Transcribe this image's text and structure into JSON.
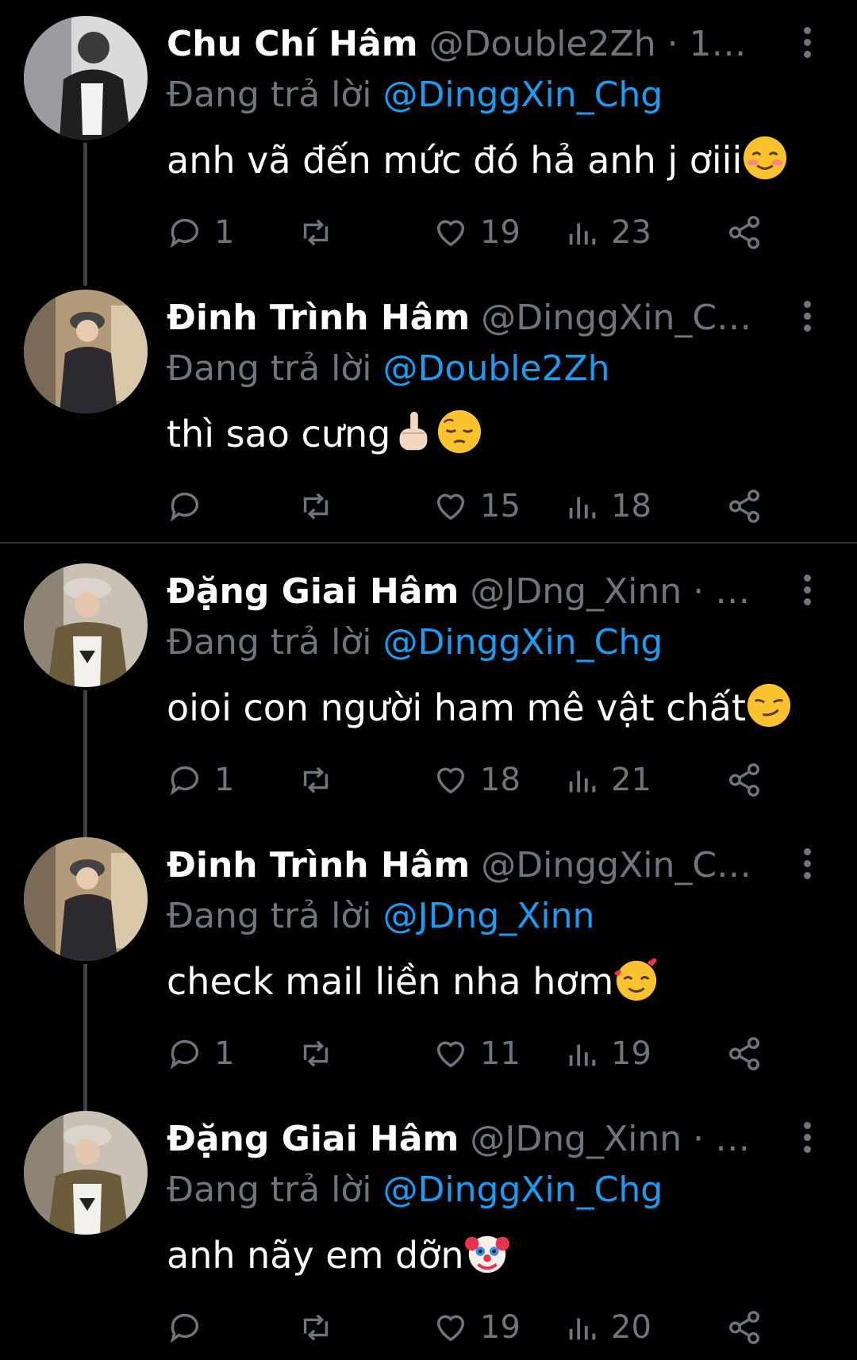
{
  "colors": {
    "background": "#000000",
    "handle_gray": "#6e767d",
    "mention_blue": "#1d9bf0",
    "thread_line": "#3d4247"
  },
  "reply_label": "Đang trả lời",
  "tweets": [
    {
      "name": "Chu Chí Hâm",
      "handle": "@Double2Zh · 1…",
      "mention": "@DinggXin_Chg",
      "text": "anh vã đến mức đó hả anh j ơiii",
      "emojis": [
        "smiling-blush-emoji"
      ],
      "replies": "1",
      "retweets": "",
      "likes": "19",
      "views": "23"
    },
    {
      "name": "Đinh Trình Hâm",
      "handle": "@DinggXin_C…",
      "mention": "@Double2Zh",
      "text": "thì sao cưng",
      "emojis": [
        "middle-finger-emoji",
        "pensive-emoji"
      ],
      "replies": "",
      "retweets": "",
      "likes": "15",
      "views": "18"
    },
    {
      "name": "Đặng Giai Hâm",
      "handle": "@JDng_Xinn · …",
      "mention": "@DinggXin_Chg",
      "text": "oioi con người ham mê vật chất",
      "emojis": [
        "smirk-emoji"
      ],
      "replies": "1",
      "retweets": "",
      "likes": "18",
      "views": "21"
    },
    {
      "name": "Đinh Trình Hâm",
      "handle": "@DinggXin_C…",
      "mention": "@JDng_Xinn",
      "text": "check mail liền nha hơm",
      "emojis": [
        "smiling-hearts-emoji"
      ],
      "replies": "1",
      "retweets": "",
      "likes": "11",
      "views": "19"
    },
    {
      "name": "Đặng Giai Hâm",
      "handle": "@JDng_Xinn · …",
      "mention": "@DinggXin_Chg",
      "text": "anh nãy em dỡn",
      "emojis": [
        "clown-emoji"
      ],
      "replies": "",
      "retweets": "",
      "likes": "19",
      "views": "20"
    }
  ]
}
